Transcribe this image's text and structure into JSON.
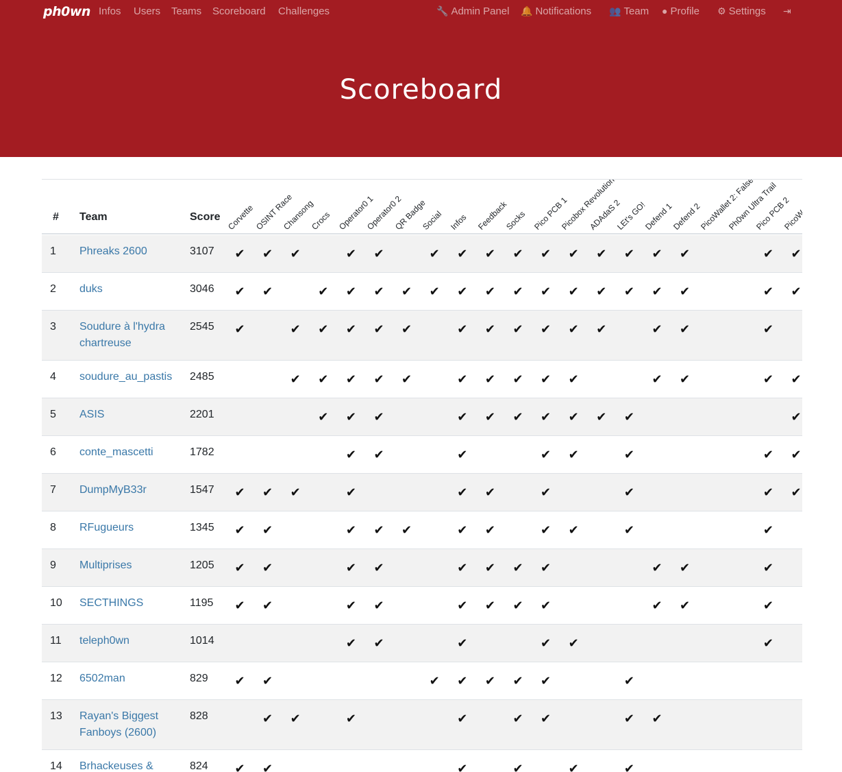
{
  "nav": {
    "brand": "ph0wn",
    "left": [
      "Infos",
      "Users",
      "Teams",
      "Scoreboard",
      "Challenges"
    ],
    "right": [
      {
        "icon": "wrench-icon",
        "label": "Admin Panel"
      },
      {
        "icon": "bell-icon",
        "label": "Notifications"
      },
      {
        "icon": "users-icon",
        "label": "Team"
      },
      {
        "icon": "user-circle-icon",
        "label": "Profile"
      },
      {
        "icon": "gears-icon",
        "label": "Settings"
      },
      {
        "icon": "logout-icon",
        "label": ""
      }
    ]
  },
  "page": {
    "title": "Scoreboard"
  },
  "table": {
    "headers": {
      "rank": "#",
      "team": "Team",
      "score": "Score"
    },
    "challenges": [
      "Corvette",
      "OSINT Race",
      "Chansong",
      "Crocs",
      "Operator0 1",
      "Operator0 2",
      "QR Badge",
      "Social",
      "Infos",
      "Feedback",
      "Socks",
      "Pico PCB 1",
      "Picobox Revolution",
      "ADAdaS 2",
      "LEt's GO!",
      "Defend 1",
      "Defend 2",
      "PicoWallet 2: False ...",
      "Ph0wn Ultra Trail",
      "Pico PCB 2",
      "PicoW"
    ],
    "rows": [
      {
        "rank": "1",
        "team": "Phreaks 2600",
        "score": "3107",
        "solves": [
          0,
          1,
          2,
          4,
          5,
          7,
          8,
          9,
          10,
          11,
          12,
          13,
          14,
          15,
          16,
          19,
          20
        ]
      },
      {
        "rank": "2",
        "team": "duks",
        "score": "3046",
        "solves": [
          0,
          1,
          3,
          4,
          5,
          6,
          7,
          8,
          9,
          10,
          11,
          12,
          13,
          14,
          15,
          16,
          19,
          20
        ]
      },
      {
        "rank": "3",
        "team": "Soudure à l'hydra chartreuse",
        "score": "2545",
        "solves": [
          0,
          2,
          3,
          4,
          5,
          6,
          8,
          9,
          10,
          11,
          12,
          13,
          15,
          16,
          19
        ]
      },
      {
        "rank": "4",
        "team": "soudure_au_pastis",
        "score": "2485",
        "solves": [
          2,
          3,
          4,
          5,
          6,
          8,
          9,
          10,
          11,
          12,
          15,
          16,
          19,
          20
        ]
      },
      {
        "rank": "5",
        "team": "ASIS",
        "score": "2201",
        "solves": [
          3,
          4,
          5,
          8,
          9,
          10,
          11,
          12,
          13,
          14,
          20
        ]
      },
      {
        "rank": "6",
        "team": "conte_mascetti",
        "score": "1782",
        "solves": [
          4,
          5,
          8,
          11,
          12,
          14,
          19,
          20
        ]
      },
      {
        "rank": "7",
        "team": "DumpMyB33r",
        "score": "1547",
        "solves": [
          0,
          1,
          2,
          4,
          8,
          9,
          11,
          14,
          19,
          20
        ]
      },
      {
        "rank": "8",
        "team": "RFugueurs",
        "score": "1345",
        "solves": [
          0,
          1,
          4,
          5,
          6,
          8,
          9,
          11,
          12,
          14,
          19
        ]
      },
      {
        "rank": "9",
        "team": "Multiprises",
        "score": "1205",
        "solves": [
          0,
          1,
          4,
          5,
          8,
          9,
          10,
          11,
          15,
          16,
          19
        ]
      },
      {
        "rank": "10",
        "team": "SECTHINGS",
        "score": "1195",
        "solves": [
          0,
          1,
          4,
          5,
          8,
          9,
          10,
          11,
          15,
          16,
          19
        ]
      },
      {
        "rank": "11",
        "team": "teleph0wn",
        "score": "1014",
        "solves": [
          4,
          5,
          8,
          11,
          12,
          19
        ]
      },
      {
        "rank": "12",
        "team": "6502man",
        "score": "829",
        "solves": [
          0,
          1,
          7,
          8,
          9,
          10,
          11,
          14
        ]
      },
      {
        "rank": "13",
        "team": "Rayan's Biggest Fanboys (2600)",
        "score": "828",
        "solves": [
          1,
          2,
          4,
          8,
          10,
          11,
          14,
          15
        ]
      },
      {
        "rank": "14",
        "team": "Brhackeuses &",
        "score": "824",
        "solves": [
          0,
          1,
          8,
          10,
          12,
          14
        ]
      }
    ],
    "check_glyph": "✔"
  }
}
